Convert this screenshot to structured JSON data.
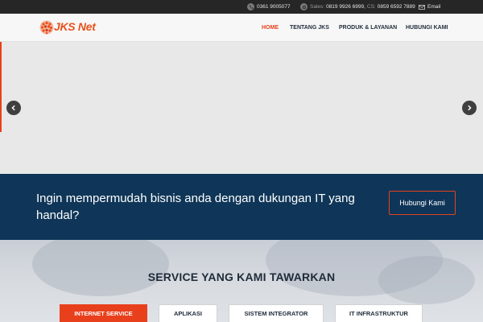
{
  "topbar": {
    "phone": "0361 9005077",
    "sales_label": "Sales:",
    "sales_phone": "0819 9926 6999,",
    "cs_label": "CS:",
    "cs_phone": "0859 6592 7889",
    "email_label": "Email"
  },
  "logo": {
    "text": "JKS Net"
  },
  "nav": {
    "home": "HOME",
    "tentang": "TENTANG JKS",
    "produk": "PRODUK & LAYANAN",
    "hubungi": "HUBUNGI KAMI"
  },
  "cta": {
    "text": "Ingin mempermudah bisnis anda dengan dukungan IT yang handal?",
    "button": "Hubungi Kami"
  },
  "services": {
    "title": "SERVICE YANG KAMI TAWARKAN",
    "tabs": [
      "INTERNET SERVICE",
      "APLIKASI",
      "SISTEM INTEGRATOR",
      "IT INFRASTRUKTUR"
    ]
  },
  "colors": {
    "accent": "#e8401d",
    "navy": "#0f3658",
    "topbar": "#262626",
    "text_dark": "#1e2b3a"
  },
  "icons": [
    "phone-icon",
    "sales-icon",
    "mail-icon",
    "chevron-left-icon",
    "chevron-right-icon"
  ]
}
